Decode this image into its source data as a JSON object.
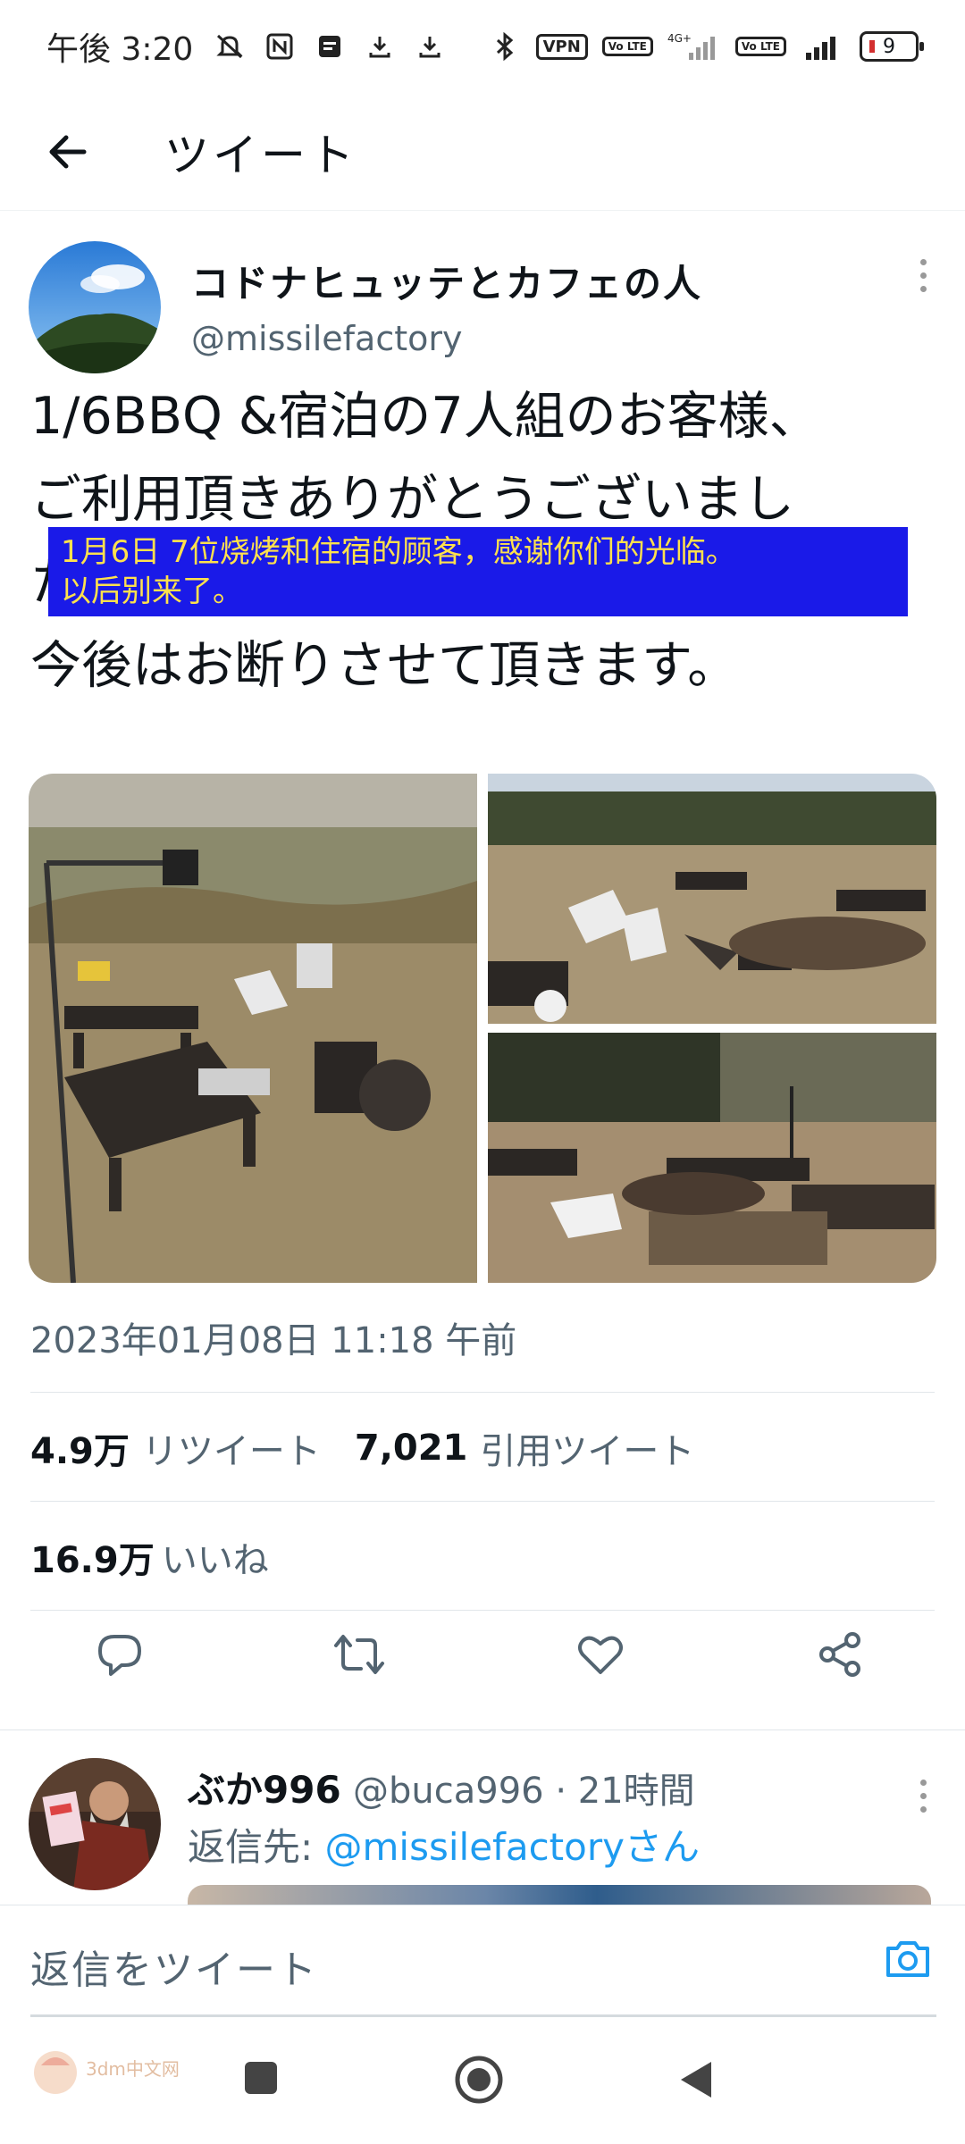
{
  "status_bar": {
    "time": "午後 3:20",
    "vpn": "VPN",
    "volte": "Vo LTE",
    "network": "4G+",
    "battery": "9"
  },
  "header": {
    "title": "ツイート"
  },
  "tweet": {
    "author_name": "コドナヒュッテとカフェの人",
    "author_handle": "@missilefactory",
    "text_line1": "1/6BBQ &宿泊の7人組のお客様、",
    "text_line2": "ご利用頂きありがとうございまし",
    "text_line3": "た。",
    "text_line4": "今後はお断りさせて頂きます。",
    "translation_line1": "1月6日 7位烧烤和住宿的顾客，感谢你们的光临。",
    "translation_line2": "以后别来了。",
    "timestamp": "2023年01月08日 11:18 午前",
    "retweets_count": "4.9万",
    "retweets_label": "リツイート",
    "quotes_count": "7,021",
    "quotes_label": "引用ツイート",
    "likes_count": "16.9万",
    "likes_label": "いいね"
  },
  "reply": {
    "name": "ぶか996",
    "handle_meta": "@buca996 · 21時間",
    "reply_to_label": "返信先: ",
    "reply_to_link": "@missilefactoryさん"
  },
  "compose": {
    "placeholder": "返信をツイート"
  },
  "watermark": "3dm中文网",
  "colors": {
    "accent": "#1d9bf0",
    "secondary_text": "#536471",
    "translation_bg": "#1a1ae8",
    "translation_text": "#ffe14d"
  }
}
